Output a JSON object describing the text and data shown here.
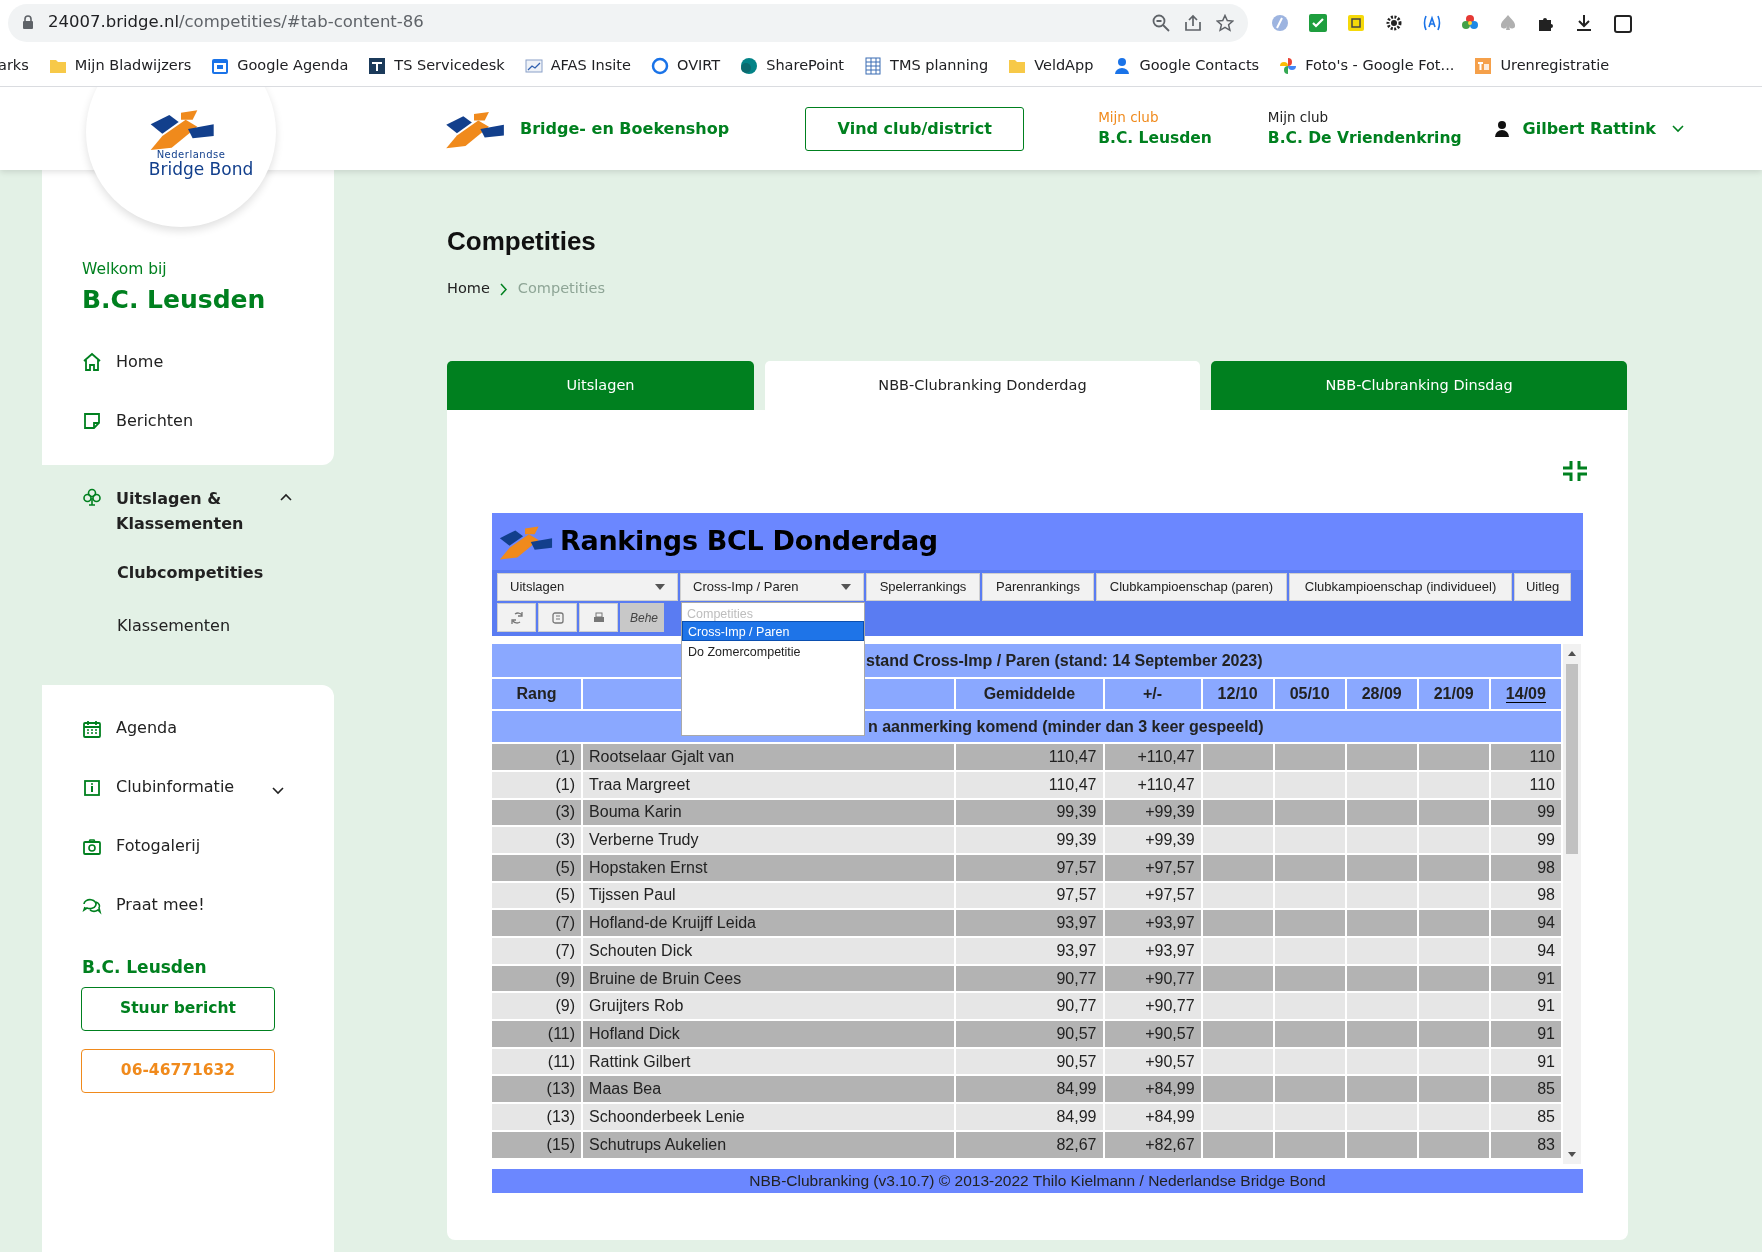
{
  "browser": {
    "url_host": "24007.bridge.nl",
    "url_path": "/competities/#tab-content-86",
    "bookmarks": [
      "arks",
      "Mijn Bladwijzers",
      "Google Agenda",
      "TS Servicedesk",
      "AFAS Insite",
      "OVIRT",
      "SharePoint",
      "TMS planning",
      "VeldApp",
      "Google Contacts",
      "Foto's - Google Fot...",
      "Urenregistratie"
    ]
  },
  "header": {
    "logo_small": "Nederlandse",
    "logo_name": "Bridge Bond",
    "shop": "Bridge- en Boekenshop",
    "find_button": "Vind club/district",
    "clubs": [
      {
        "label": "Mijn club",
        "name": "B.C. Leusden",
        "selected": true
      },
      {
        "label": "Mijn club",
        "name": "B.C. De Vriendenkring",
        "selected": false
      }
    ],
    "user": "Gilbert Rattink"
  },
  "sidebar": {
    "welcome": "Welkom bij",
    "club": "B.C. Leusden",
    "groups": [
      {
        "items": [
          {
            "label": "Home"
          },
          {
            "label": "Berichten"
          }
        ]
      },
      {
        "items": [
          {
            "label": "Uitslagen & Klassementen",
            "expanded": true,
            "children": [
              {
                "label": "Clubcompetities",
                "selected": true
              },
              {
                "label": "Klassementen",
                "selected": false
              }
            ]
          }
        ]
      },
      {
        "items": [
          {
            "label": "Agenda"
          },
          {
            "label": "Clubinformatie",
            "expanded": false
          },
          {
            "label": "Fotogalerij"
          },
          {
            "label": "Praat mee!"
          }
        ]
      }
    ],
    "contact": {
      "title": "B.C. Leusden",
      "buttons": [
        {
          "label": "Stuur bericht",
          "kind": "primary"
        },
        {
          "label": "06-46771632",
          "kind": "phone"
        }
      ]
    }
  },
  "page": {
    "title": "Competities",
    "breadcrumb": [
      {
        "label": "Home",
        "current": false
      },
      {
        "label": "Competities",
        "current": true
      }
    ],
    "tabs": [
      {
        "label": "Uitslagen",
        "selected": false
      },
      {
        "label": "NBB-Clubranking Donderdag",
        "selected": true
      },
      {
        "label": "NBB-Clubranking Dinsdag",
        "selected": false
      }
    ]
  },
  "ranking": {
    "title": "Rankings BCL Donderdag",
    "menu": [
      {
        "label": "Uitslagen",
        "kind": "dropdown"
      },
      {
        "label": "Cross-Imp / Paren",
        "kind": "dropdown"
      },
      {
        "label": "Spelerrankings",
        "kind": "button"
      },
      {
        "label": "Parenrankings",
        "kind": "button"
      },
      {
        "label": "Clubkampioenschap (paren)",
        "kind": "button"
      },
      {
        "label": "Clubkampioenschap (individueel)",
        "kind": "button"
      },
      {
        "label": "Uitleg",
        "kind": "button"
      }
    ],
    "tools_label": "Behe",
    "dropdown": {
      "header": "Competities",
      "options": [
        {
          "label": "Cross-Imp / Paren",
          "selected": true
        },
        {
          "label": "Do Zomercompetitie",
          "selected": false
        }
      ]
    },
    "table_title": "stand Cross-Imp / Paren (stand: 14 September 2023)",
    "columns": [
      {
        "label": "Rang",
        "sorted": false
      },
      {
        "label": "Gemiddelde",
        "sorted": false
      },
      {
        "label": "+/-",
        "sorted": false
      },
      {
        "label": "12/10",
        "sorted": false
      },
      {
        "label": "05/10",
        "sorted": false
      },
      {
        "label": "28/09",
        "sorted": false
      },
      {
        "label": "21/09",
        "sorted": false
      },
      {
        "label": "14/09",
        "sorted": true
      }
    ],
    "note": "n aanmerking komend (minder dan 3 keer gespeeld)",
    "rows": [
      {
        "rank": "(1)",
        "name": "Rootselaar Gjalt van",
        "avg": "110,47",
        "diff": "+110,47",
        "scores": [
          "110"
        ]
      },
      {
        "rank": "(1)",
        "name": "Traa Margreet",
        "avg": "110,47",
        "diff": "+110,47",
        "scores": [
          "110"
        ]
      },
      {
        "rank": "(3)",
        "name": "Bouma Karin",
        "avg": "99,39",
        "diff": "+99,39",
        "scores": [
          "99"
        ]
      },
      {
        "rank": "(3)",
        "name": "Verberne Trudy",
        "avg": "99,39",
        "diff": "+99,39",
        "scores": [
          "99"
        ]
      },
      {
        "rank": "(5)",
        "name": "Hopstaken Ernst",
        "avg": "97,57",
        "diff": "+97,57",
        "scores": [
          "98"
        ]
      },
      {
        "rank": "(5)",
        "name": "Tijssen Paul",
        "avg": "97,57",
        "diff": "+97,57",
        "scores": [
          "98"
        ]
      },
      {
        "rank": "(7)",
        "name": "Hofland-de Kruijff Leida",
        "avg": "93,97",
        "diff": "+93,97",
        "scores": [
          "94"
        ]
      },
      {
        "rank": "(7)",
        "name": "Schouten Dick",
        "avg": "93,97",
        "diff": "+93,97",
        "scores": [
          "94"
        ]
      },
      {
        "rank": "(9)",
        "name": "Bruine de Bruin Cees",
        "avg": "90,77",
        "diff": "+90,77",
        "scores": [
          "91"
        ]
      },
      {
        "rank": "(9)",
        "name": "Gruijters Rob",
        "avg": "90,77",
        "diff": "+90,77",
        "scores": [
          "91"
        ]
      },
      {
        "rank": "(11)",
        "name": "Hofland Dick",
        "avg": "90,57",
        "diff": "+90,57",
        "scores": [
          "91"
        ]
      },
      {
        "rank": "(11)",
        "name": "Rattink Gilbert",
        "avg": "90,57",
        "diff": "+90,57",
        "scores": [
          "91"
        ]
      },
      {
        "rank": "(13)",
        "name": "Maas Bea",
        "avg": "84,99",
        "diff": "+84,99",
        "scores": [
          "85"
        ]
      },
      {
        "rank": "(13)",
        "name": "Schoonderbeek Lenie",
        "avg": "84,99",
        "diff": "+84,99",
        "scores": [
          "85"
        ]
      },
      {
        "rank": "(15)",
        "name": "Schutrups Aukelien",
        "avg": "82,67",
        "diff": "+82,67",
        "scores": [
          "83"
        ]
      }
    ],
    "footer": "NBB-Clubranking (v3.10.7) © 2013-2022 Thilo Kielmann / Nederlandse Bridge Bond"
  }
}
